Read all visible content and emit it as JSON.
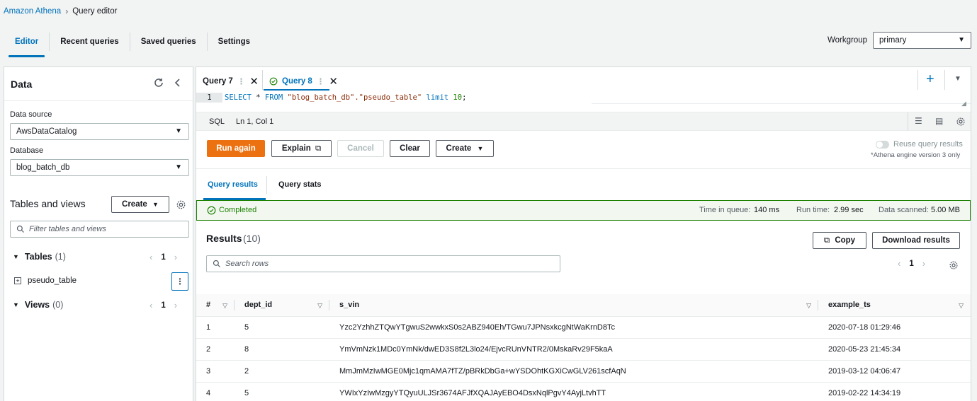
{
  "breadcrumb": {
    "root": "Amazon Athena",
    "current": "Query editor"
  },
  "top_tabs": [
    "Editor",
    "Recent queries",
    "Saved queries",
    "Settings"
  ],
  "workgroup": {
    "label": "Workgroup",
    "value": "primary"
  },
  "left": {
    "title": "Data",
    "data_source_label": "Data source",
    "data_source_value": "AwsDataCatalog",
    "database_label": "Database",
    "database_value": "blog_batch_db",
    "tables_views_title": "Tables and views",
    "create_label": "Create",
    "filter_placeholder": "Filter tables and views",
    "tables_label": "Tables",
    "tables_count": "(1)",
    "tables_page": "1",
    "table_item": "pseudo_table",
    "views_label": "Views",
    "views_count": "(0)",
    "views_page": "1"
  },
  "editor": {
    "tabs": [
      "Query 7",
      "Query 8"
    ],
    "line_no": "1",
    "sql_kw1": "SELECT",
    "sql_mid1": " * ",
    "sql_kw2": "FROM",
    "sql_str": " \"blog_batch_db\".\"pseudo_table\" ",
    "sql_kw3": "limit",
    "sql_num": " 10",
    "sql_end": ";",
    "lang": "SQL",
    "position": "Ln 1, Col 1",
    "buttons": {
      "run": "Run again",
      "explain": "Explain",
      "cancel": "Cancel",
      "clear": "Clear",
      "create": "Create"
    },
    "reuse_label": "Reuse query results",
    "reuse_note": "*Athena engine version 3 only"
  },
  "results": {
    "tabs": [
      "Query results",
      "Query stats"
    ],
    "status": "Completed",
    "time_in_queue_label": "Time in queue:",
    "time_in_queue": "140 ms",
    "run_time_label": "Run time:",
    "run_time": "2.99 sec",
    "data_scanned_label": "Data scanned:",
    "data_scanned": "5.00 MB",
    "title": "Results",
    "count": "(10)",
    "copy_label": "Copy",
    "download_label": "Download results",
    "search_placeholder": "Search rows",
    "page": "1",
    "columns": [
      "#",
      "dept_id",
      "s_vin",
      "example_ts"
    ],
    "rows": [
      [
        "1",
        "5",
        "Yzc2YzhhZTQwYTgwuS2wwkxS0s2ABZ940Eh/TGwu7JPNsxkcgNtWaKrnD8Tc",
        "2020-07-18 01:29:46"
      ],
      [
        "2",
        "8",
        "YmVmNzk1MDc0YmNk/dwED3S8f2L3lo24/EjvcRUnVNTR2/0MskaRv29F5kaA",
        "2020-05-23 21:45:34"
      ],
      [
        "3",
        "2",
        "MmJmMzIwMGE0Mjc1qmAMA7fTZ/pBRkDbGa+wYSDOhtKGXiCwGLV261scfAqN",
        "2019-03-12 04:06:47"
      ],
      [
        "4",
        "5",
        "YWIxYzIwMzgyYTQyuULJSr3674AFJfXQAJAyEBO4DsxNqlPgvY4AyjLtvhTT",
        "2019-02-22 14:34:19"
      ]
    ]
  }
}
